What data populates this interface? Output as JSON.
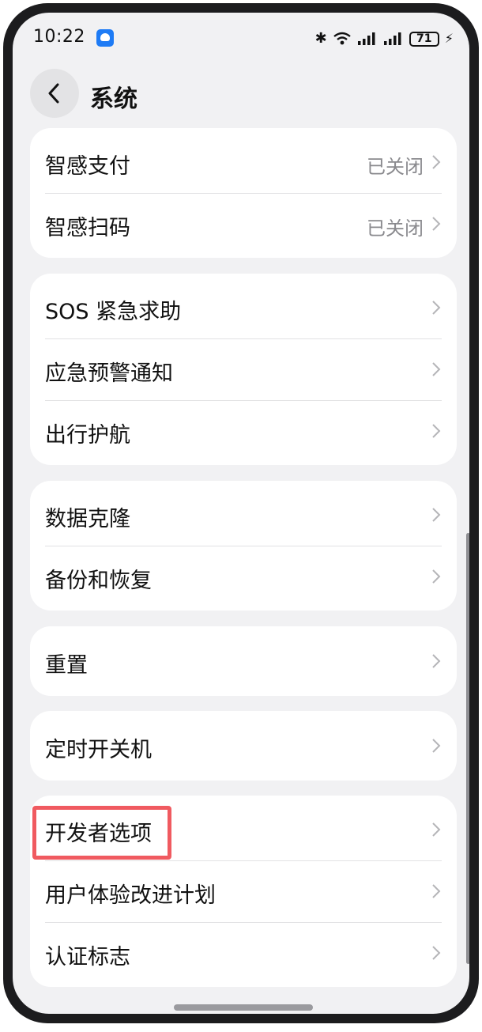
{
  "status": {
    "time": "10:22",
    "battery": "71"
  },
  "header": {
    "title": "系统"
  },
  "groups": [
    {
      "items": [
        {
          "label": "智感支付",
          "value": "已关闭"
        },
        {
          "label": "智感扫码",
          "value": "已关闭"
        }
      ]
    },
    {
      "items": [
        {
          "label": "SOS 紧急求助"
        },
        {
          "label": "应急预警通知"
        },
        {
          "label": "出行护航"
        }
      ]
    },
    {
      "items": [
        {
          "label": "数据克隆"
        },
        {
          "label": "备份和恢复"
        }
      ]
    },
    {
      "items": [
        {
          "label": "重置"
        }
      ]
    },
    {
      "items": [
        {
          "label": "定时开关机"
        }
      ]
    },
    {
      "items": [
        {
          "label": "开发者选项"
        },
        {
          "label": "用户体验改进计划"
        },
        {
          "label": "认证标志"
        }
      ]
    }
  ],
  "colors": {
    "highlight": "#f05a60",
    "background": "#f1f1f3"
  }
}
